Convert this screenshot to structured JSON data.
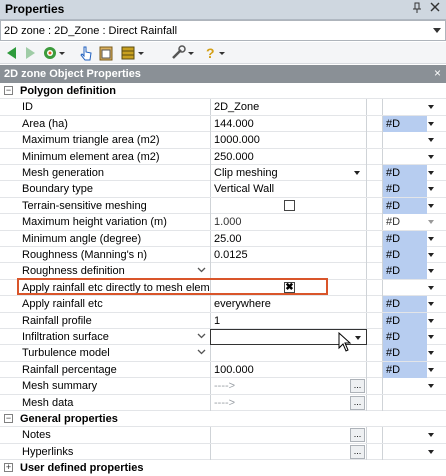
{
  "panel": {
    "title": "Properties",
    "pin_icon": "pin-icon",
    "close_icon": "close-icon"
  },
  "object_selector": {
    "value": "2D zone : 2D_Zone : Direct Rainfall"
  },
  "toolbar": {
    "icons": [
      "back-arrow-icon",
      "forward-arrow-icon",
      "filter-icon",
      "pointer-icon",
      "paste-icon",
      "database-icon",
      "wrench-icon",
      "help-icon"
    ]
  },
  "section_header": {
    "label": "2D zone Object Properties",
    "close_glyph": "×"
  },
  "grid": {
    "polygon_definition": "Polygon definition",
    "general_properties": "General properties",
    "user_defined_properties": "User defined properties",
    "rows": [
      {
        "label": "ID",
        "value": "2D_Zone",
        "tag": ""
      },
      {
        "label": "Area (ha)",
        "value": "144.000",
        "tag": "#D"
      },
      {
        "label": "Maximum triangle area (m2)",
        "value": "1000.000",
        "tag": ""
      },
      {
        "label": "Minimum element area (m2)",
        "value": "250.000",
        "tag": ""
      },
      {
        "label": "Mesh generation",
        "value": "Clip meshing",
        "tag": "#D"
      },
      {
        "label": "Boundary type",
        "value": "Vertical Wall",
        "tag": "#D"
      },
      {
        "label": "Terrain-sensitive meshing",
        "value": "",
        "tag": "#D"
      },
      {
        "label": "Maximum height variation (m)",
        "value": "1.000",
        "tag": "#D"
      },
      {
        "label": "Minimum angle (degree)",
        "value": "25.00",
        "tag": "#D"
      },
      {
        "label": "Roughness (Manning's n)",
        "value": "0.0125",
        "tag": "#D"
      },
      {
        "label": "Roughness definition",
        "value": "",
        "tag": "#D"
      },
      {
        "label": "Apply rainfall etc directly to mesh elem",
        "value": "",
        "tag": ""
      },
      {
        "label": "Apply rainfall etc",
        "value": "everywhere",
        "tag": "#D"
      },
      {
        "label": "Rainfall profile",
        "value": "1",
        "tag": "#D"
      },
      {
        "label": "Infiltration surface",
        "value": "",
        "tag": "#D"
      },
      {
        "label": "Turbulence model",
        "value": "",
        "tag": "#D"
      },
      {
        "label": "Rainfall percentage",
        "value": "100.000",
        "tag": "#D"
      },
      {
        "label": "Mesh summary",
        "value": "---->",
        "tag": ""
      },
      {
        "label": "Mesh data",
        "value": "---->",
        "tag": ""
      },
      {
        "label": "Notes",
        "value": "",
        "tag": ""
      },
      {
        "label": "Hyperlinks",
        "value": "",
        "tag": ""
      }
    ],
    "ellipsis": "...",
    "checked_glyph": "✖"
  }
}
